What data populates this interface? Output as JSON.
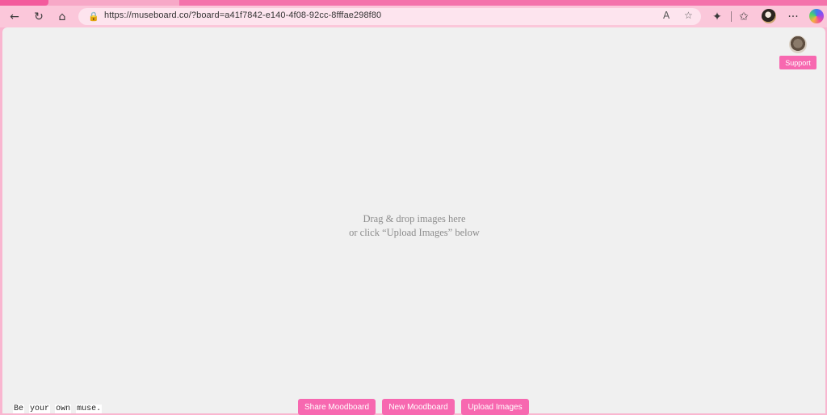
{
  "browser": {
    "url": "https://museboard.co/?board=a41f7842-e140-4f08-92cc-8fffae298f80",
    "icons": {
      "back": "←",
      "refresh": "↻",
      "home": "⌂",
      "lock": "🔒",
      "read_aloud": "A",
      "favorite": "☆",
      "extensions": "✦",
      "favorites": "✩",
      "more": "···"
    }
  },
  "page": {
    "support_label": "Support",
    "drop_hint_line1": "Drag & drop images here",
    "drop_hint_line2": "or click “Upload Images” below",
    "tagline_words": [
      "Be",
      "your",
      "own",
      "muse."
    ],
    "buttons": {
      "share": "Share Moodboard",
      "new": "New Moodboard",
      "upload": "Upload Images"
    }
  },
  "colors": {
    "accent": "#f768b0",
    "page_background": "#f0f0f0",
    "browser_chrome": "#fbc7da"
  }
}
